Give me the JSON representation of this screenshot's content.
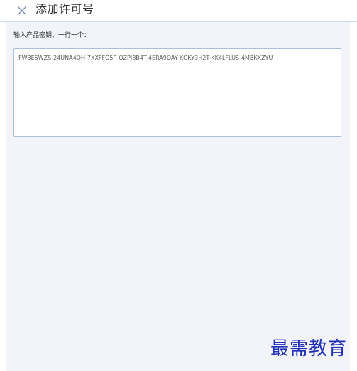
{
  "dialog": {
    "title": "添加许可号",
    "close_icon": "close-icon"
  },
  "form": {
    "label": "输入产品密钥，一行一个：",
    "keys_value": "FW3E5WZS-24UNA4QH-7XXFFG5P-QZPJ8B4T-4ERA9QAY-KGKY3H2T-KK4LFLUS-4MBKXZYU"
  },
  "watermark": {
    "text": "最需教育"
  },
  "colors": {
    "header_border": "#cfdbea",
    "panel_bg": "#f2f4f9",
    "textarea_border": "#a9c0da",
    "close_icon": "#7a8fb0",
    "watermark": "#1f2fb8"
  }
}
